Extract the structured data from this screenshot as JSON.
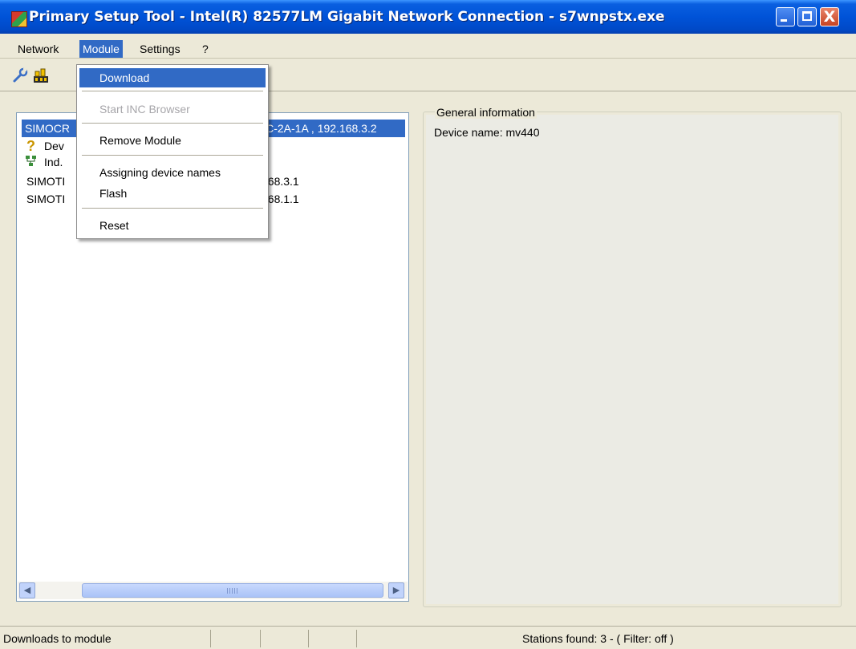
{
  "window": {
    "title": "Primary Setup Tool - Intel(R) 82577LM Gigabit Network Connection - s7wnpstx.exe",
    "minimize_glyph": "_",
    "close_glyph": "X"
  },
  "menubar": {
    "items": [
      {
        "label": "Network"
      },
      {
        "label": "Module"
      },
      {
        "label": "Settings"
      },
      {
        "label": "?"
      }
    ],
    "active": "Module"
  },
  "toolbar": {
    "icons": [
      "wrench-icon",
      "browse-network-icon"
    ]
  },
  "module_menu": {
    "items": [
      {
        "label": "Download",
        "state": "highlighted"
      },
      {
        "label": "Start INC Browser",
        "state": "disabled"
      },
      {
        "label": "Remove Module",
        "state": "enabled"
      },
      {
        "label": "Assigning device names",
        "state": "enabled"
      },
      {
        "label": "Flash",
        "state": "enabled"
      },
      {
        "label": "Reset",
        "state": "enabled"
      }
    ]
  },
  "tree": {
    "rows": [
      {
        "label": "SIMOCR",
        "suffix": "DC-2A-1A , 192.168.3.2",
        "selected": true
      },
      {
        "label": "Dev",
        "icon": "question-icon"
      },
      {
        "label": "Ind.",
        "icon": "network-interface-icon"
      },
      {
        "label": "SIMOTI",
        "suffix": "168.3.1"
      },
      {
        "label": "SIMOTI",
        "suffix": "168.1.1"
      }
    ]
  },
  "info_panel": {
    "legend": "General information",
    "device_name_label": "Device name:",
    "device_name_value": "mv440"
  },
  "status_bar": {
    "message": "Downloads to module",
    "stations": "Stations found: 3 - ( Filter: off )"
  },
  "colors": {
    "title_blue": "#0053d8",
    "selection": "#316ac5",
    "window_face": "#ece9d8"
  }
}
